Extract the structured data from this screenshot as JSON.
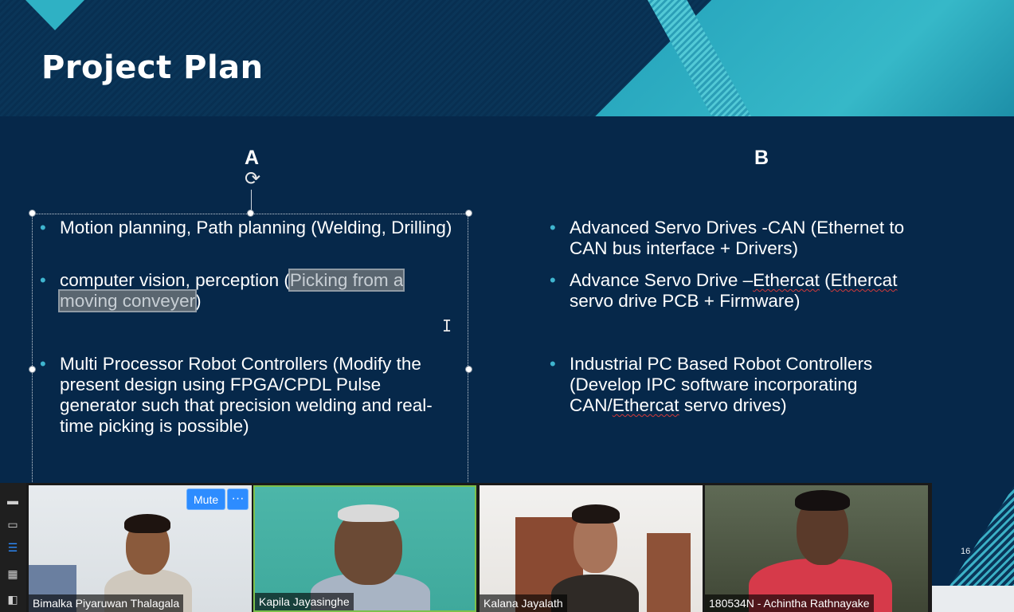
{
  "slide": {
    "title": "Project Plan",
    "page_number": "16",
    "column_a": {
      "heading": "A",
      "bullets": [
        {
          "text": "Motion planning, Path planning  (Welding, Drilling)"
        },
        {
          "prefix": "computer vision, perception (",
          "highlight1": "Picking from a",
          "highlight2": "moving conveyer",
          "suffix": ")"
        },
        {
          "text": "Multi Processor Robot Controllers (Modify the present design using FPGA/CPDL Pulse generator such that precision welding and real-time picking is possible)"
        }
      ]
    },
    "column_b": {
      "heading": "B",
      "bullets": [
        {
          "text": "Advanced Servo Drives -CAN (Ethernet to CAN bus interface + Drivers)"
        },
        {
          "part1": "Advance Servo Drive –",
          "word1": "Ethercat",
          "part2": " (",
          "word2": "Ethercat",
          "part3": " servo drive PCB + Firmware)"
        },
        {
          "part1": "Industrial PC Based Robot Controllers (Develop IPC software incorporating CAN/",
          "word1": "Ethercat",
          "part2": " servo drives)"
        }
      ]
    }
  },
  "meeting": {
    "controls": {
      "mute_label": "Mute",
      "more_label": "···"
    },
    "side_tools": [
      "minimize-icon",
      "speaker-view-icon",
      "strip-view-icon",
      "gallery-view-icon",
      "side-by-side-icon"
    ],
    "participants": [
      {
        "name": "Bimalka Piyaruwan Thalagala"
      },
      {
        "name": "Kapila Jayasinghe",
        "speaking": true
      },
      {
        "name": "Kalana Jayalath"
      },
      {
        "name": "180534N - Achintha Rathnayake"
      }
    ]
  }
}
